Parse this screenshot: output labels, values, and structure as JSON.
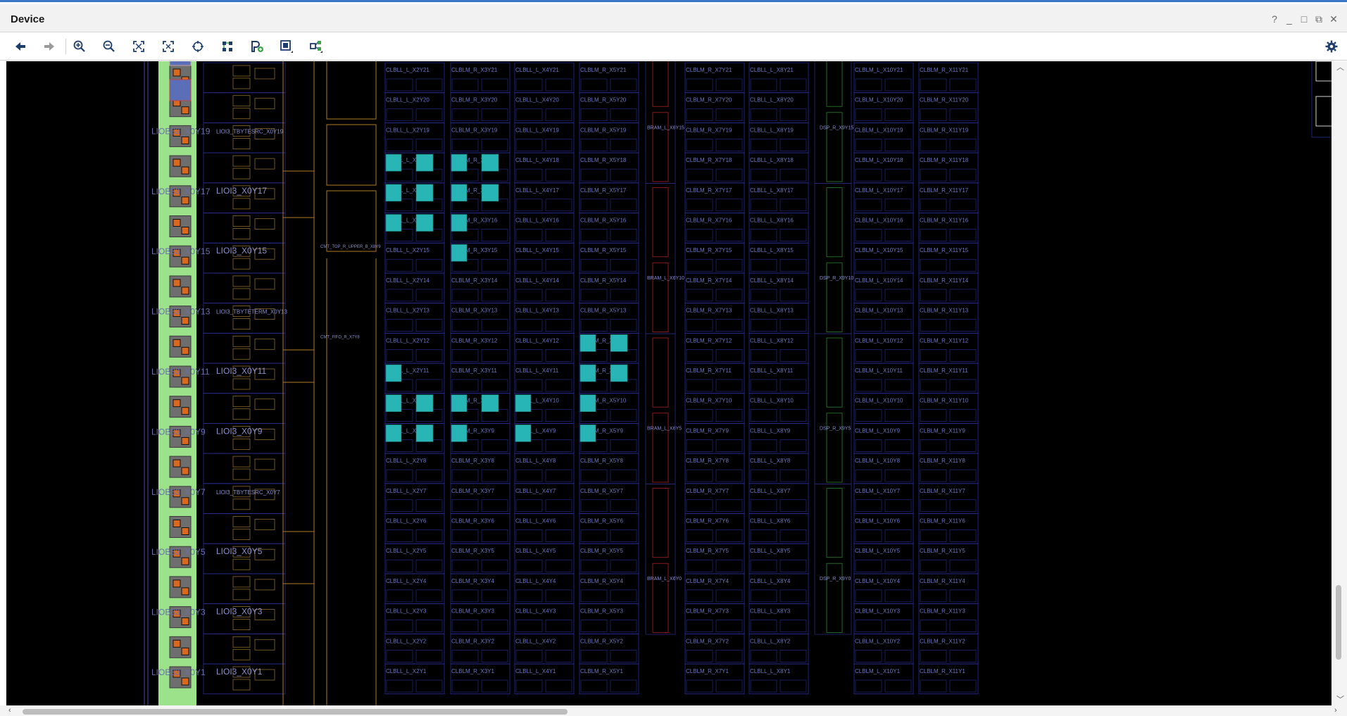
{
  "window": {
    "title": "Device"
  },
  "window_controls": [
    "?",
    "_",
    "□",
    "⧉",
    "✕"
  ],
  "toolbar": {
    "buttons": [
      {
        "icon": "back-arrow-icon"
      },
      {
        "icon": "forward-arrow-icon"
      },
      {
        "icon": "zoom-in-icon"
      },
      {
        "icon": "zoom-out-icon"
      },
      {
        "icon": "zoom-fit-icon"
      },
      {
        "icon": "zoom-selection-icon"
      },
      {
        "icon": "autofit-selection-icon"
      },
      {
        "icon": "routing-resources-icon"
      },
      {
        "icon": "add-pblock-icon"
      },
      {
        "icon": "draw-pblock-icon"
      },
      {
        "icon": "expand-connections-icon"
      }
    ],
    "settings_icon": "gear-icon"
  },
  "colors": {
    "canvas": "#000000",
    "tile_border": "#2a2f9a",
    "clb_label": "#6e78c8",
    "placed_cell": "#27b5b5",
    "io_bank": "#9be28a",
    "bram_border": "#8a1b1b",
    "dsp_border": "#1f6b1f",
    "clock_border": "#b07a1f"
  },
  "device": {
    "rows": [
      21,
      20,
      19,
      18,
      17,
      16,
      15,
      14,
      13,
      12,
      11,
      10,
      9,
      8,
      7,
      6,
      5,
      4,
      3,
      2,
      1
    ],
    "columns": [
      {
        "prefix": "CLBLL_L_X2Y"
      },
      {
        "prefix": "CLBLM_R_X3Y"
      },
      {
        "prefix": "CLBLL_L_X4Y"
      },
      {
        "prefix": "CLBLM_R_X5Y"
      },
      {
        "prefix": "CLBLM_R_X7Y"
      },
      {
        "prefix": "CLBLL_L_X8Y"
      },
      {
        "prefix": "CLBLM_L_X10Y"
      },
      {
        "prefix": "CLBLM_R_X11Y"
      }
    ],
    "io_labels": [
      {
        "left": "LIOB33_X0Y19",
        "right": "LIOI3_TBYTESRC_X0Y19",
        "row": 19
      },
      {
        "left": "LIOB33_X0Y17",
        "right": "LIOI3_X0Y17",
        "row": 17
      },
      {
        "left": "LIOB33_X0Y15",
        "right": "LIOI3_X0Y15",
        "row": 15
      },
      {
        "left": "LIOB33_X0Y13",
        "right": "LIOI3_TBYTETERM_X0Y13",
        "row": 13
      },
      {
        "left": "LIOB33_X0Y11",
        "right": "LIOI3_X0Y11",
        "row": 11
      },
      {
        "left": "LIOB33_X0Y9",
        "right": "LIOI3_X0Y9",
        "row": 9
      },
      {
        "left": "LIOB33_X0Y7",
        "right": "LIOI3_TBYTESRC_X0Y7",
        "row": 7
      },
      {
        "left": "LIOB33_X0Y5",
        "right": "LIOI3_X0Y5",
        "row": 5
      },
      {
        "left": "LIOB33_X0Y3",
        "right": "LIOI3_X0Y3",
        "row": 3
      },
      {
        "left": "LIOB33_X0Y1",
        "right": "LIOI3_X0Y1",
        "row": 1
      }
    ],
    "bram_labels": [
      {
        "text": "BRAM_L_X6Y15",
        "row": 19
      },
      {
        "text": "BRAM_L_X6Y10",
        "row": 14
      },
      {
        "text": "BRAM_L_X6Y5",
        "row": 9
      },
      {
        "text": "BRAM_L_X6Y0",
        "row": 4
      }
    ],
    "dsp_labels": [
      {
        "text": "DSP_R_X9Y15",
        "row": 19
      },
      {
        "text": "DSP_R_X9Y10",
        "row": 14
      },
      {
        "text": "DSP_R_X9Y5",
        "row": 9
      },
      {
        "text": "DSP_R_X9Y0",
        "row": 4
      }
    ],
    "clock_labels": [
      {
        "text": "CMT_TOP_R_UPPER_B_X8Y9",
        "row": 15
      },
      {
        "text": "CMT_FIFO_R_X7Y8",
        "row": 12
      }
    ],
    "placed_cells": [
      {
        "col": 0,
        "row": 18,
        "slices": [
          0,
          1
        ]
      },
      {
        "col": 0,
        "row": 17,
        "slices": [
          0,
          1
        ]
      },
      {
        "col": 0,
        "row": 16,
        "slices": [
          0,
          1
        ]
      },
      {
        "col": 0,
        "row": 11,
        "slices": [
          0
        ]
      },
      {
        "col": 0,
        "row": 10,
        "slices": [
          0,
          1
        ]
      },
      {
        "col": 0,
        "row": 9,
        "slices": [
          0,
          1
        ]
      },
      {
        "col": 1,
        "row": 18,
        "slices": [
          0,
          1
        ]
      },
      {
        "col": 1,
        "row": 17,
        "slices": [
          0,
          1
        ]
      },
      {
        "col": 1,
        "row": 16,
        "slices": [
          0
        ]
      },
      {
        "col": 1,
        "row": 15,
        "slices": [
          0
        ]
      },
      {
        "col": 1,
        "row": 10,
        "slices": [
          0,
          1
        ]
      },
      {
        "col": 1,
        "row": 9,
        "slices": [
          0
        ]
      },
      {
        "col": 2,
        "row": 10,
        "slices": [
          0
        ]
      },
      {
        "col": 2,
        "row": 9,
        "slices": [
          0
        ]
      },
      {
        "col": 3,
        "row": 12,
        "slices": [
          0,
          1
        ]
      },
      {
        "col": 3,
        "row": 11,
        "slices": [
          0,
          1
        ]
      },
      {
        "col": 3,
        "row": 10,
        "slices": [
          0
        ]
      },
      {
        "col": 3,
        "row": 9,
        "slices": [
          0
        ]
      }
    ]
  }
}
